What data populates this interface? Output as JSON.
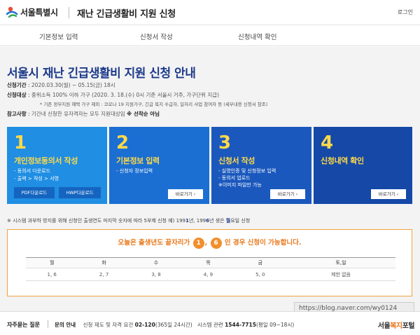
{
  "header": {
    "logo_text": "서울특별시",
    "title": "재난 긴급생활비 지원 신청",
    "login": "로그인"
  },
  "nav": {
    "items": [
      "기본정보 입력",
      "신청서 작성",
      "신청내역 확인"
    ]
  },
  "main": {
    "title": "서울시 재난 긴급생활비 지원 신청 안내",
    "period_label": "신청기간",
    "period_value": "2020.03.30(월) ~ 05.15(금) 18시",
    "target_label": "신청대상",
    "target_value": "중위소득 100% 이하 가구 (2020. 3. 18.(수) 0시 기준 서울시 거주, 가구단위 지급)",
    "target_note": "* 기존 정부지원 혜택 가구 제외 : 코로나 19 지원가구, 긴급 복지 수급자, 일자리 사업 참여자 등 (세부내용 신청서 참조)",
    "ref_label": "참고사항",
    "ref_value": "기간내 신청한 유자격자는 모두 지원대상임",
    "ref_strong": "※ 선착순 아님"
  },
  "steps": [
    {
      "num": "1",
      "title": "개인정보동의서 작성",
      "lines": [
        "- 동의서 다운로드",
        "- 출력 > 작성 > 서명"
      ],
      "buttons": [
        "PDF다운로드",
        "HWP다운로드"
      ]
    },
    {
      "num": "2",
      "title": "기본정보 입력",
      "lines": [
        "- 신청자 정보입력"
      ],
      "button": "바로가기"
    },
    {
      "num": "3",
      "title": "신청서 작성",
      "lines": [
        "- 실명인증 및 신청정보 입력",
        "- 동의서 업로드",
        "※이미지 파일만 가능"
      ],
      "button": "바로가기"
    },
    {
      "num": "4",
      "title": "신청내역 확인",
      "lines": [],
      "button": "바로가기"
    }
  ],
  "colors": {
    "card1": "#1f8ee3",
    "card2": "#1b6fd2",
    "card3": "#1a58bd",
    "card4": "#1548a7",
    "accent_orange": "#f28e2b",
    "title_blue": "#1d3a8a"
  },
  "warning": {
    "text_a": "※ 시스템 과부하 방지를 위해 신청인 출생연도 마지막 숫자에 따라 5부제 신청   예) 199",
    "b1": "1",
    "text_b": "년, 199",
    "b2": "6",
    "text_c": "년 생은 ",
    "b3": "월",
    "text_d": "요일 신청"
  },
  "schedule": {
    "msg_a": "오늘은 출생년도 끝자리가",
    "digit1": "1",
    "sep": ",",
    "digit2": "6",
    "msg_b": "인 경우 신청이 가능합니다.",
    "days": [
      "월",
      "화",
      "수",
      "목",
      "금",
      "토,일"
    ],
    "digits": [
      "1, 6",
      "2, 7",
      "3, 8",
      "4, 9",
      "5, 0",
      "제한 없음"
    ]
  },
  "footer": {
    "faq": "자주묻는 질문",
    "inquiry_label": "문의 안내",
    "inquiry_a": "신청 제도 및 자격 요건",
    "phone_a": "02-120",
    "inquiry_a2": "(365일 24시간)",
    "inquiry_b": "시스템 관련",
    "phone_b": "1544-7715",
    "inquiry_b2": "(평일 09~18시)",
    "brand_a": "서울",
    "brand_b": "복지",
    "brand_c": "포털"
  },
  "watermark": "https://blog.naver.com/wy0124"
}
